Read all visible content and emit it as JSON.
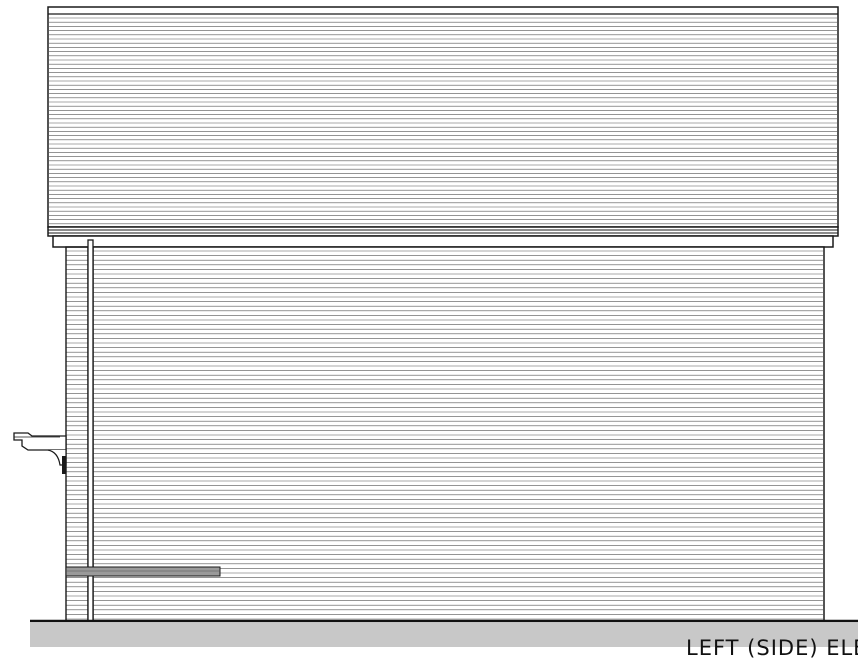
{
  "drawing": {
    "caption": "LEFT (SIDE) ELEVATION"
  },
  "colors": {
    "line": "#1a1a1a",
    "siding_line": "#555555",
    "ground": "#c8c8c8",
    "band_fill": "#9a9a9a"
  }
}
